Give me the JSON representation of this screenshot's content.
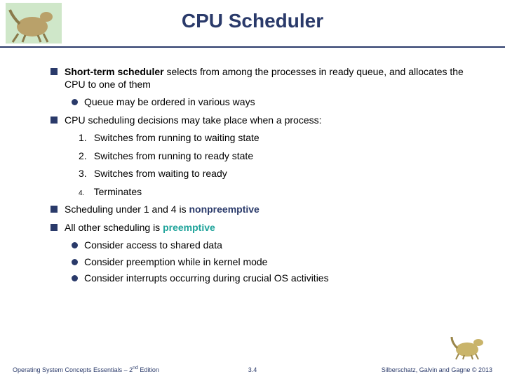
{
  "title": "CPU Scheduler",
  "bullets": {
    "b1_pre": "Short-term scheduler",
    "b1_post": " selects from among the processes in ready queue, and allocates the CPU to one of them",
    "b1_sub1": "Queue may be ordered in various ways",
    "b2": "CPU scheduling decisions may take place when a process:",
    "n1_num": "1.",
    "n1": "Switches from running to waiting state",
    "n2_num": "2.",
    "n2": "Switches from running to ready state",
    "n3_num": "3.",
    "n3": "Switches from waiting to ready",
    "n4_num": "4.",
    "n4": "Terminates",
    "b3_pre": "Scheduling under 1 and 4 is ",
    "b3_term": "nonpreemptive",
    "b4_pre": "All other scheduling is ",
    "b4_term": "preemptive",
    "b4_sub1": "Consider access to shared data",
    "b4_sub2": "Consider preemption while in kernel mode",
    "b4_sub3": "Consider interrupts occurring during crucial OS activities"
  },
  "footer": {
    "left_pre": "Operating System Concepts Essentials – 2",
    "left_sup": "nd",
    "left_post": " Edition",
    "center": "3.4",
    "right": "Silberschatz, Galvin and Gagne © 2013"
  },
  "icons": {
    "dino_top": "dinosaur-illustration",
    "dino_bottom": "dinosaur-illustration"
  }
}
